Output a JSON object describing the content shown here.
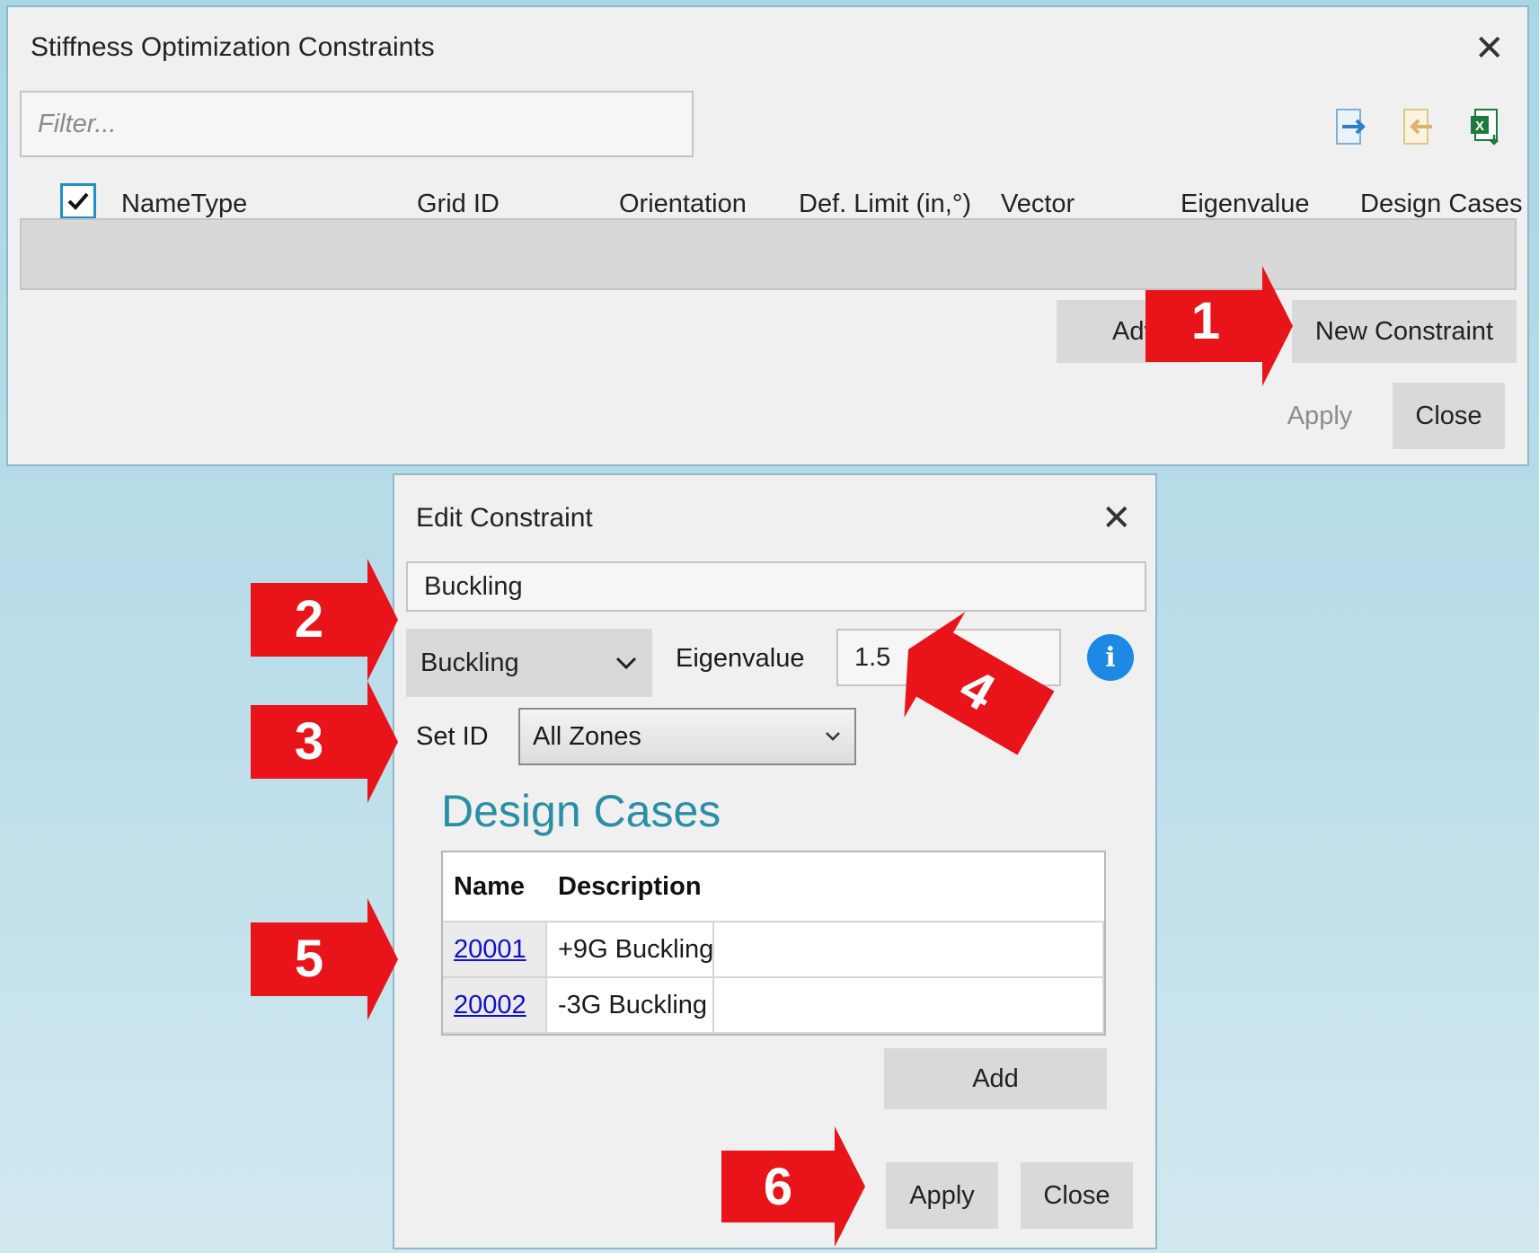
{
  "main_dialog": {
    "title": "Stiffness Optimization Constraints",
    "filter_placeholder": "Filter...",
    "toolbar_icons": [
      "export-icon",
      "import-icon",
      "excel-icon"
    ],
    "columns": [
      "NameType",
      "Grid ID",
      "Orientation",
      "Def. Limit (in,°)",
      "Vector",
      "Eigenvalue",
      "Design Cases"
    ],
    "select_all_checked": true,
    "advanced_label": "Adv",
    "new_constraint_label": "New Constraint",
    "apply_label": "Apply",
    "close_label": "Close"
  },
  "edit_dialog": {
    "title": "Edit Constraint",
    "name_value": "Buckling",
    "type_value": "Buckling",
    "eigenvalue_label": "Eigenvalue",
    "eigenvalue_value": "1.5",
    "set_id_label": "Set ID",
    "set_id_value": "All Zones",
    "design_cases_title": "Design Cases",
    "table_headers": [
      "Name",
      "Description"
    ],
    "rows": [
      {
        "name": "20001",
        "description": "+9G Buckling"
      },
      {
        "name": "20002",
        "description": "-3G Buckling"
      }
    ],
    "add_label": "Add",
    "apply_label": "Apply",
    "close_label": "Close"
  },
  "callouts": [
    "1",
    "2",
    "3",
    "4",
    "5",
    "6"
  ],
  "colors": {
    "callout_red": "#e8141a",
    "accent_teal": "#2a8fa6",
    "info_blue": "#1e88e5",
    "link_blue": "#1010d0"
  }
}
